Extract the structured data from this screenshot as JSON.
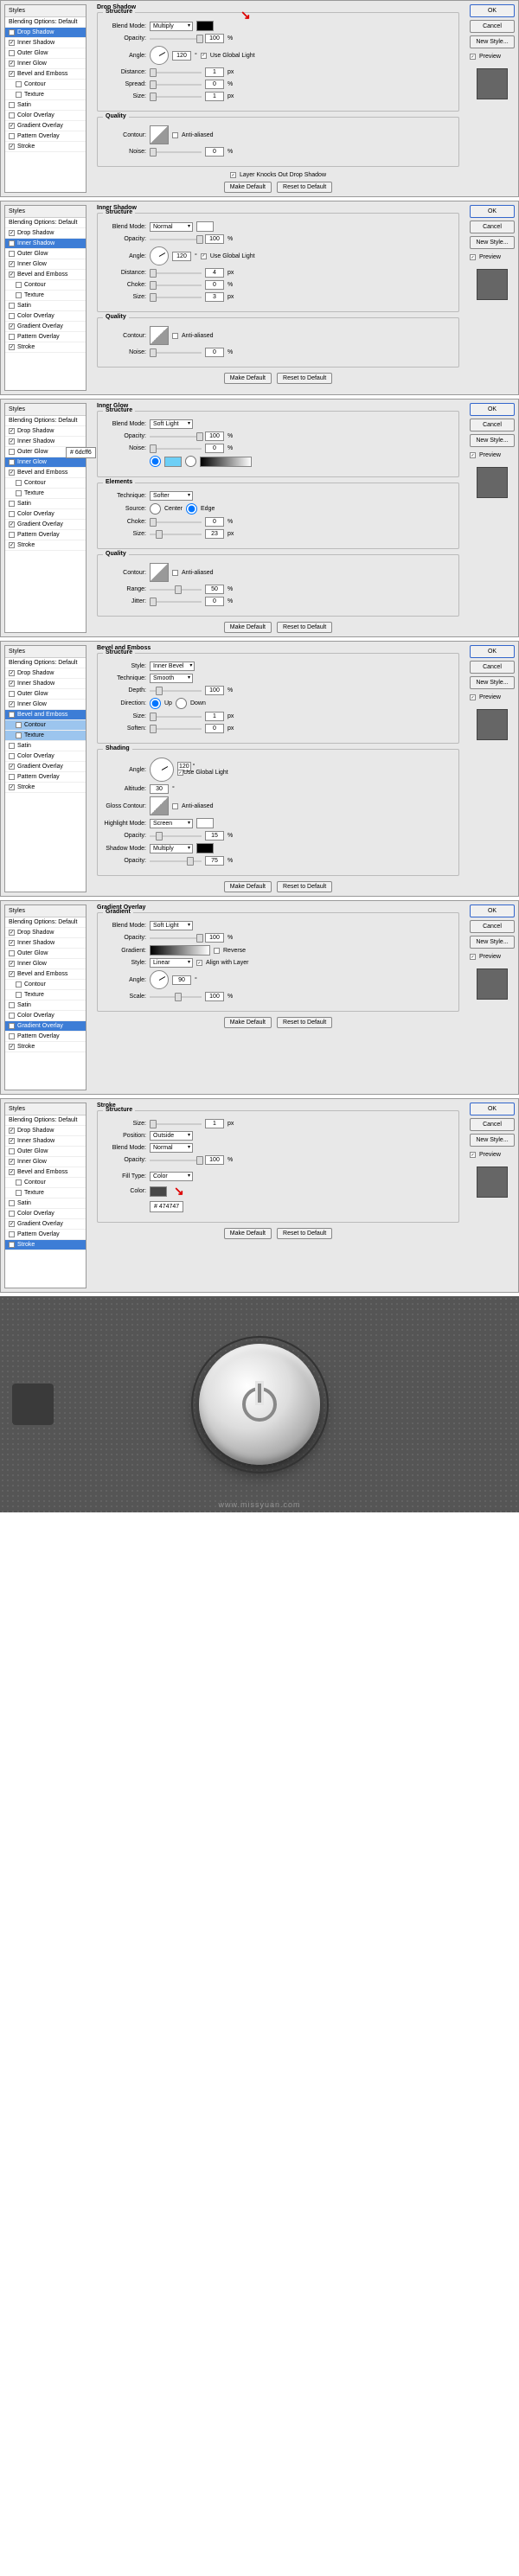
{
  "sidebar": {
    "header": "Styles",
    "blending": "Blending Options: Default",
    "items": [
      {
        "label": "Drop Shadow",
        "chk": true
      },
      {
        "label": "Inner Shadow",
        "chk": true
      },
      {
        "label": "Outer Glow",
        "chk": false
      },
      {
        "label": "Inner Glow",
        "chk": true
      },
      {
        "label": "Bevel and Emboss",
        "chk": true
      },
      {
        "label": "Contour",
        "chk": false,
        "sub": true
      },
      {
        "label": "Texture",
        "chk": false,
        "sub": true
      },
      {
        "label": "Satin",
        "chk": false
      },
      {
        "label": "Color Overlay",
        "chk": false
      },
      {
        "label": "Gradient Overlay",
        "chk": true
      },
      {
        "label": "Pattern Overlay",
        "chk": false
      },
      {
        "label": "Stroke",
        "chk": true
      }
    ]
  },
  "buttons": {
    "ok": "OK",
    "cancel": "Cancel",
    "newstyle": "New Style...",
    "preview": "Preview",
    "default": "Make Default",
    "reset": "Reset to Default"
  },
  "labels": {
    "blend": "Blend Mode:",
    "opacity": "Opacity:",
    "angle": "Angle:",
    "distance": "Distance:",
    "spread": "Spread:",
    "size": "Size:",
    "choke": "Choke:",
    "noise": "Noise:",
    "contour": "Contour:",
    "anti": "Anti-aliased",
    "global": "Use Global Light",
    "knock": "Layer Knocks Out Drop Shadow",
    "technique": "Technique:",
    "source": "Source:",
    "range": "Range:",
    "jitter": "Jitter:",
    "style": "Style:",
    "depth": "Depth:",
    "direction": "Direction:",
    "soften": "Soften:",
    "altitude": "Altitude:",
    "gloss": "Gloss Contour:",
    "highlight": "Highlight Mode:",
    "shadow": "Shadow Mode:",
    "gradient": "Gradient:",
    "reverse": "Reverse",
    "align": "Align with Layer",
    "scale": "Scale:",
    "position": "Position:",
    "filltype": "Fill Type:",
    "color": "Color:",
    "center": "Center",
    "edge": "Edge",
    "up": "Up",
    "down": "Down",
    "structure": "Structure",
    "quality": "Quality",
    "elements": "Elements",
    "shading": "Shading"
  },
  "panels": {
    "ds": {
      "title": "Drop Shadow",
      "blend": "Multiply",
      "opacity": "100",
      "angle": "120",
      "distance": "1",
      "spread": "0",
      "size": "1",
      "noise": "0"
    },
    "is": {
      "title": "Inner Shadow",
      "blend": "Normal",
      "opacity": "100",
      "angle": "120",
      "distance": "4",
      "choke": "0",
      "size": "3",
      "noise": "0"
    },
    "ig": {
      "title": "Inner Glow",
      "blend": "Soft Light",
      "opacity": "100",
      "noise": "0",
      "technique": "Softer",
      "choke": "0",
      "size": "23",
      "range": "50",
      "jitter": "0",
      "tip": "6dcff6"
    },
    "be": {
      "title": "Bevel and Emboss",
      "style": "Inner Bevel",
      "technique": "Smooth",
      "depth": "100",
      "size": "1",
      "soften": "0",
      "angle": "120",
      "altitude": "30",
      "hmode": "Screen",
      "hopacity": "15",
      "smode": "Multiply",
      "sopacity": "75"
    },
    "go": {
      "title": "Gradient Overlay",
      "blend": "Soft Light",
      "opacity": "100",
      "style": "Linear",
      "angle": "90",
      "scale": "100"
    },
    "st": {
      "title": "Stroke",
      "size": "1",
      "position": "Outside",
      "blend": "Normal",
      "opacity": "100",
      "filltype": "Color",
      "hex": "474747"
    }
  },
  "watermark": "www.missyuan.com"
}
